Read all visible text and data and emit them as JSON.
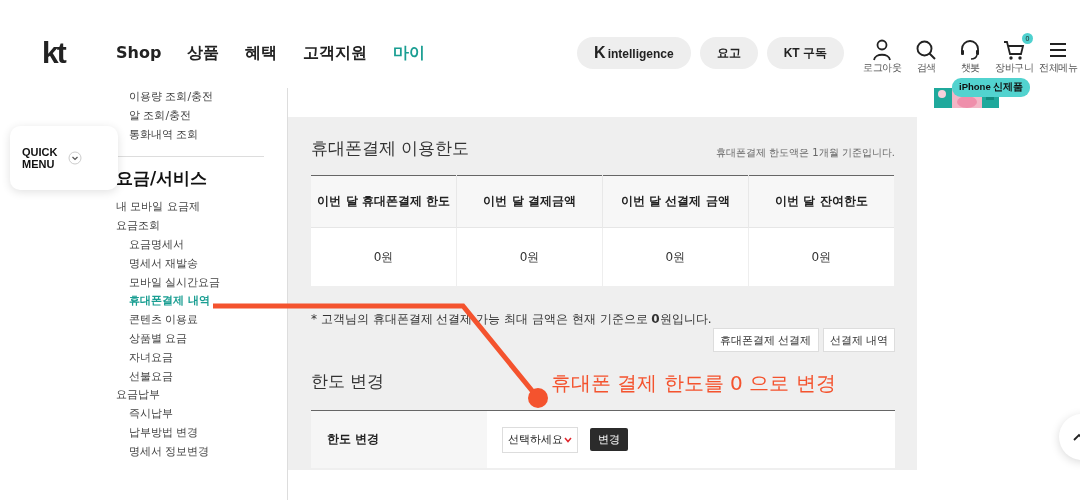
{
  "header": {
    "logo": "kt",
    "nav": [
      {
        "label": "Shop",
        "selected": false
      },
      {
        "label": "상품",
        "selected": false
      },
      {
        "label": "혜택",
        "selected": false
      },
      {
        "label": "고객지원",
        "selected": false
      },
      {
        "label": "마이",
        "selected": true
      }
    ],
    "pills": [
      {
        "mark": "K",
        "label": "intelligence"
      },
      {
        "label": "요고"
      },
      {
        "label": "KT 구독"
      }
    ],
    "icons": [
      {
        "kind": "person",
        "label": "로그아웃"
      },
      {
        "kind": "search",
        "label": "검색"
      },
      {
        "kind": "headset",
        "label": "챗봇"
      },
      {
        "kind": "cart",
        "label": "장바구니",
        "badge": "0"
      },
      {
        "kind": "menu",
        "label": "전체메뉴"
      }
    ],
    "tooltip": "iPhone 신제품"
  },
  "quick_menu": {
    "label": "QUICK MENU"
  },
  "sidebar": {
    "top_items": [
      {
        "label": "이용량 조회/충전",
        "selected": false
      },
      {
        "label": "알 조회/충전",
        "selected": false
      },
      {
        "label": "통화내역 조회",
        "selected": false
      }
    ],
    "section_title": "요금/서비스",
    "items": [
      {
        "label": "내 모바일 요금제",
        "selected": false
      },
      {
        "label": "요금조회",
        "selected": false,
        "children": [
          {
            "label": "요금명세서",
            "selected": false
          },
          {
            "label": "명세서 재발송",
            "selected": false
          },
          {
            "label": "모바일 실시간요금",
            "selected": false
          },
          {
            "label": "휴대폰결제 내역",
            "selected": true
          },
          {
            "label": "콘텐츠 이용료",
            "selected": false
          },
          {
            "label": "상품별 요금",
            "selected": false
          },
          {
            "label": "자녀요금",
            "selected": false
          },
          {
            "label": "선불요금",
            "selected": false
          }
        ]
      },
      {
        "label": "요금납부",
        "selected": false,
        "children": [
          {
            "label": "즉시납부",
            "selected": false
          },
          {
            "label": "납부방법 변경",
            "selected": false
          },
          {
            "label": "명세서 정보변경",
            "selected": false
          }
        ]
      }
    ]
  },
  "limit_section": {
    "title": "휴대폰결제 이용한도",
    "note": "휴대폰결제 한도액은 1개월 기준입니다.",
    "table": {
      "columns": [
        "이번 달 휴대폰결제 한도",
        "이번 달 결제금액",
        "이번 달 선결제 금액",
        "이번 달 잔여한도"
      ],
      "rows": [
        [
          "0원",
          "0원",
          "0원",
          "0원"
        ]
      ]
    },
    "footnote": "* 고객님의 휴대폰결제 선결제 가능 최대 금액은 현재 기준으로 **0**원입니다.",
    "buttons": [
      "휴대폰결제 선결제",
      "선결제 내역"
    ]
  },
  "change_section": {
    "title": "한도 변경",
    "row_label": "한도 변경",
    "select": {
      "placeholder": "선택하세요"
    },
    "button": "변경"
  },
  "annotation": {
    "text": "휴대폰 결제 한도를 0 으로 변경"
  }
}
